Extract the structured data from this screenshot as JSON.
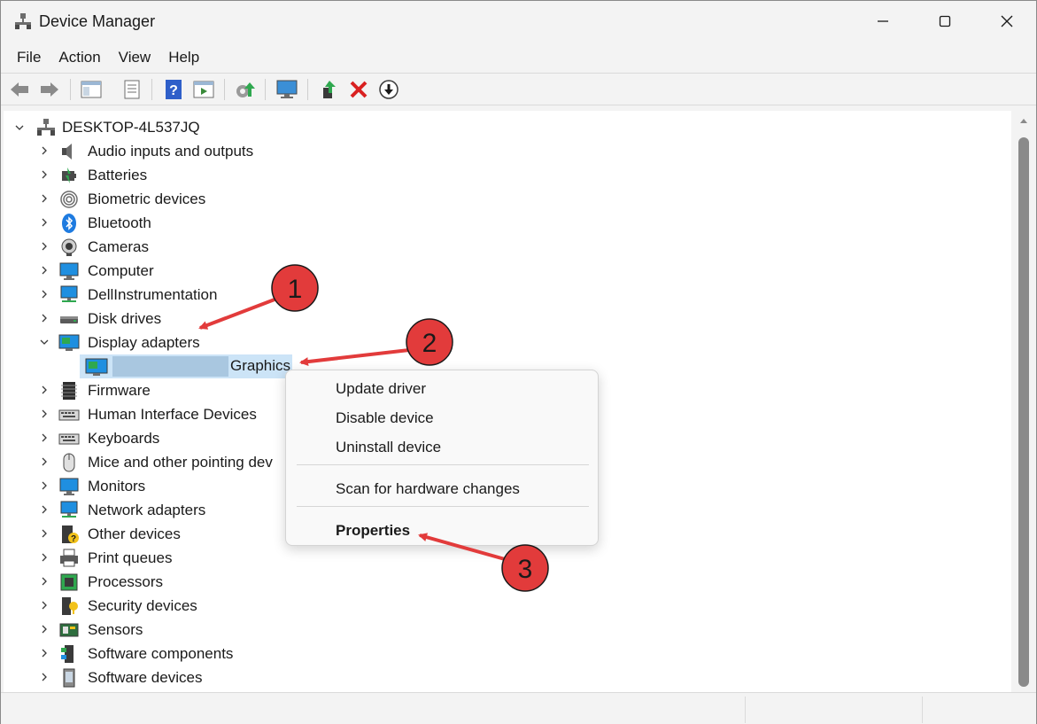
{
  "window": {
    "title": "Device Manager"
  },
  "menu": [
    "File",
    "Action",
    "View",
    "Help"
  ],
  "toolbar": {
    "buttons": [
      "back-icon",
      "forward-icon",
      "show-hide-console-tree-icon",
      "properties-icon",
      "help-icon",
      "view-icon",
      "update-driver-icon",
      "scan-hardware-icon",
      "enable-device-icon",
      "uninstall-icon",
      "disable-device-icon"
    ]
  },
  "tree": {
    "root": "DESKTOP-4L537JQ",
    "categories": [
      {
        "label": "Audio inputs and outputs",
        "icon": "speaker-icon",
        "expanded": false
      },
      {
        "label": "Batteries",
        "icon": "battery-icon",
        "expanded": false
      },
      {
        "label": "Biometric devices",
        "icon": "fingerprint-icon",
        "expanded": false
      },
      {
        "label": "Bluetooth",
        "icon": "bluetooth-icon",
        "expanded": false
      },
      {
        "label": "Cameras",
        "icon": "camera-icon",
        "expanded": false
      },
      {
        "label": "Computer",
        "icon": "computer-icon",
        "expanded": false
      },
      {
        "label": "DellInstrumentation",
        "icon": "network-monitor-icon",
        "expanded": false
      },
      {
        "label": "Disk drives",
        "icon": "disk-drive-icon",
        "expanded": false
      },
      {
        "label": "Display adapters",
        "icon": "display-adapter-icon",
        "expanded": true
      },
      {
        "label": "Firmware",
        "icon": "chip-icon",
        "expanded": false
      },
      {
        "label": "Human Interface Devices",
        "icon": "keyboard-icon",
        "expanded": false
      },
      {
        "label": "Keyboards",
        "icon": "keyboard-icon",
        "expanded": false
      },
      {
        "label": "Mice and other pointing dev",
        "icon": "mouse-icon",
        "expanded": false
      },
      {
        "label": "Monitors",
        "icon": "monitor-icon",
        "expanded": false
      },
      {
        "label": "Network adapters",
        "icon": "network-monitor-icon",
        "expanded": false
      },
      {
        "label": "Other devices",
        "icon": "unknown-device-icon",
        "expanded": false
      },
      {
        "label": "Print queues",
        "icon": "printer-icon",
        "expanded": false
      },
      {
        "label": "Processors",
        "icon": "processor-icon",
        "expanded": false
      },
      {
        "label": "Security devices",
        "icon": "security-device-icon",
        "expanded": false
      },
      {
        "label": "Sensors",
        "icon": "sensor-icon",
        "expanded": false
      },
      {
        "label": "Software components",
        "icon": "software-component-icon",
        "expanded": false
      },
      {
        "label": "Software devices",
        "icon": "software-device-icon",
        "expanded": false
      }
    ],
    "selected_child": "Graphics"
  },
  "context_menu": {
    "items": [
      "Update driver",
      "Disable device",
      "Uninstall device",
      "Scan for hardware changes",
      "Properties"
    ]
  },
  "annotations": [
    "1",
    "2",
    "3"
  ],
  "colors": {
    "selection": "#cce4f7",
    "redacted": "#a9c7e0",
    "annotation_red": "#e23b3b",
    "chrome": "#f3f3f3"
  }
}
